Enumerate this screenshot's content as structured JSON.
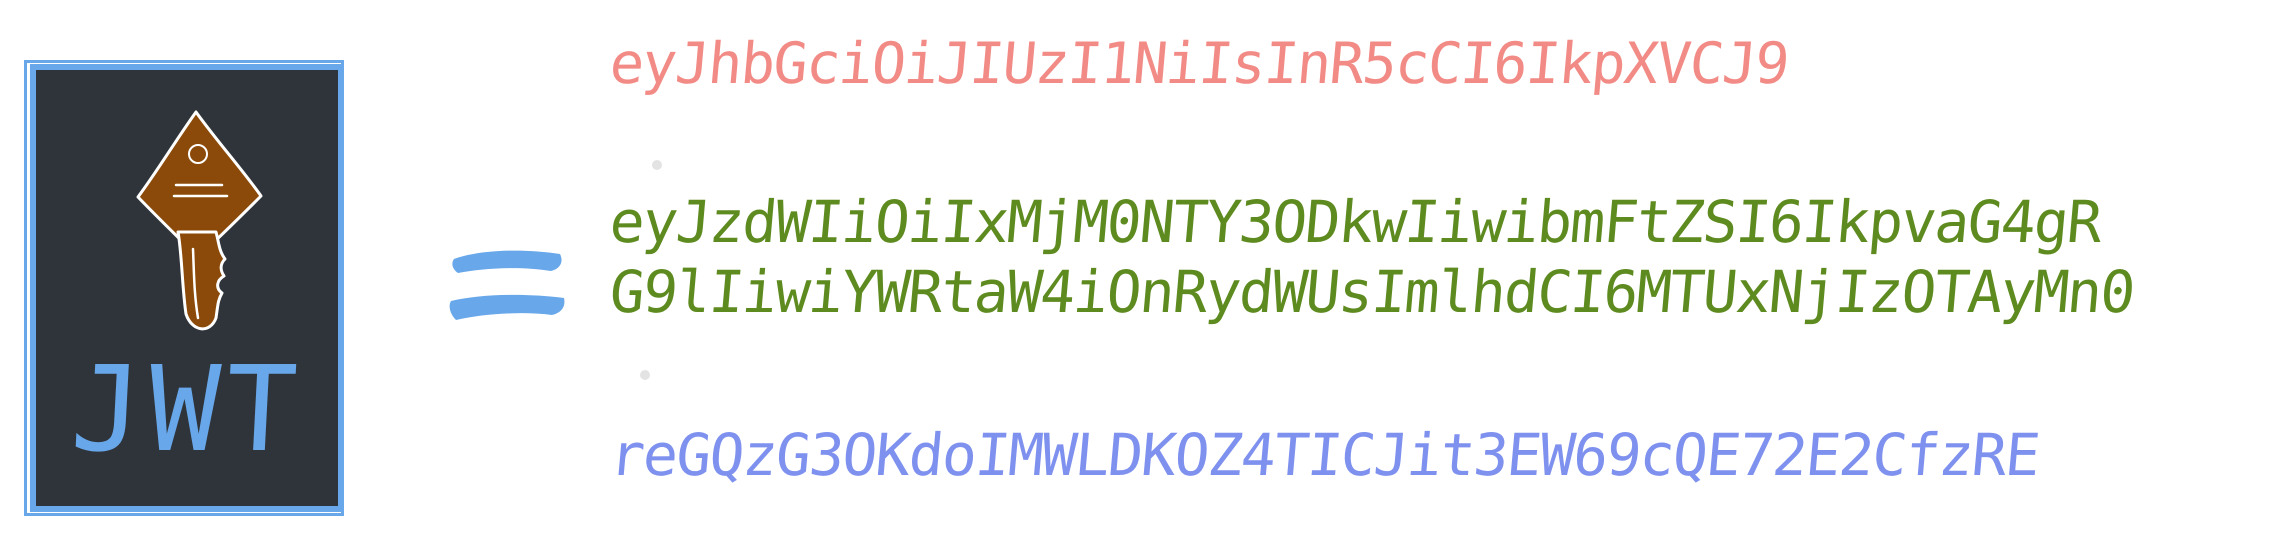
{
  "card": {
    "label": "JWT",
    "icon": "key-icon"
  },
  "equals_icon": "equals-icon",
  "token": {
    "header": "eyJhbGciOiJIUzI1NiIsInR5cCI6IkpXVCJ9",
    "payload_line_1": "eyJzdWIiOiIxMjM0NTY3ODkwIiwibmFtZSI6IkpvaG4gR",
    "payload_line_2": "G9lIiwiYWRtaW4iOnRydWUsImlhdCI6MTUxNjIzOTAyMn0",
    "signature": "reGQzG3OKdoIMWLDKOZ4TICJit3EW69cQE72E2CfzRE"
  },
  "colors": {
    "card_background": "#2f343a",
    "card_border": "#67a7ea",
    "header": "#f28b86",
    "payload": "#5e8b20",
    "signature": "#7f91ee",
    "key": "#8b4a09"
  }
}
